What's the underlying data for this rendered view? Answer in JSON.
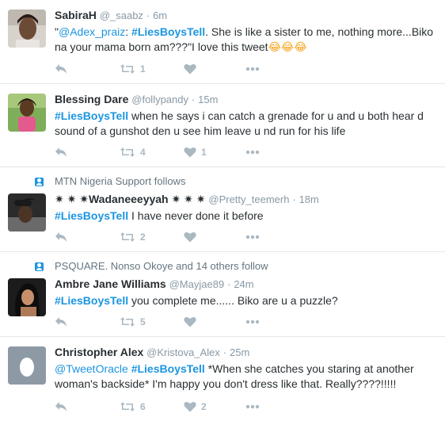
{
  "colors": {
    "link": "#1b95e0",
    "muted": "#8899a6",
    "action_icon": "#aab8c2",
    "divider": "#e1e8ed"
  },
  "tweets": [
    {
      "fullname": "SabiraH",
      "username": "@_saabz",
      "dot": "·",
      "time": "6m",
      "mention": "@Adex_praiz",
      "hashtag": "#LiesBoysTell",
      "text_before": "\"",
      "text_between": ": ",
      "text_after": ". She is like a sister to me, nothing more...Biko na your mama born am???\"I love this tweet",
      "emojis": "😂😂😂",
      "retweets": "1",
      "likes": ""
    },
    {
      "fullname": "Blessing Dare",
      "username": "@follypandy",
      "dot": "·",
      "time": "15m",
      "hashtag": "#LiesBoysTell",
      "text_after": " when he says i can catch a grenade for u and u both hear d sound of a gunshot den u see him leave u nd run for his life",
      "retweets": "4",
      "likes": "1"
    },
    {
      "context": "MTN Nigeria Support follows",
      "fullname": "✷ ✷ ✷Wadaneeeyyah ✷ ✷ ✷",
      "username": "@Pretty_teemerh",
      "dot": "·",
      "time": "18m",
      "hashtag": "#LiesBoysTell",
      "text_after": " I have never done it before",
      "retweets": "2",
      "likes": ""
    },
    {
      "context": "PSQUARE. Nonso Okoye and 14 others follow",
      "fullname": "Ambre Jane Williams",
      "username": "@Mayjae89",
      "dot": "·",
      "time": "24m",
      "hashtag": "#LiesBoysTell",
      "text_after": " you complete me...... Biko are u a puzzle?",
      "retweets": "5",
      "likes": ""
    },
    {
      "fullname": "Christopher Alex",
      "username": "@Kristova_Alex",
      "dot": "·",
      "time": "25m",
      "mention": "@TweetOracle",
      "hashtag": "#LiesBoysTell",
      "text_between": " ",
      "text_after": " *When she catches you staring at another woman's backside* I'm happy you don't dress like that. Really????!!!!!",
      "retweets": "6",
      "likes": "2"
    }
  ]
}
